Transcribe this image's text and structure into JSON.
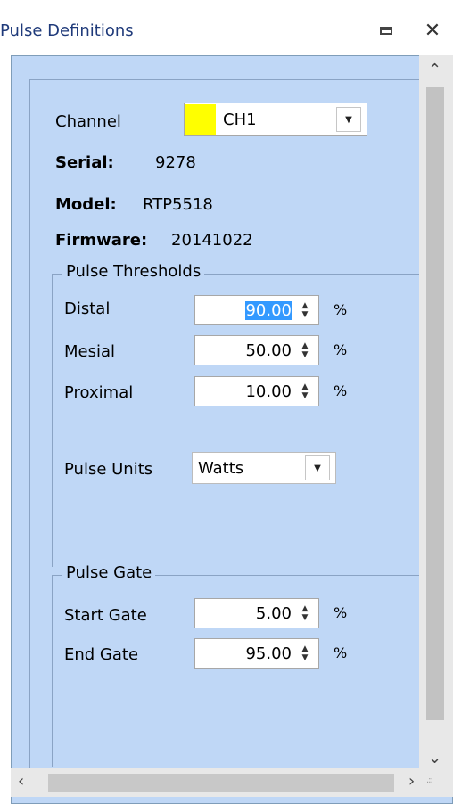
{
  "window": {
    "title": "Pulse Definitions"
  },
  "device": {
    "channel_label": "Channel",
    "channel_value": "CH1",
    "channel_color": "#ffff00",
    "serial_label": "Serial:",
    "serial_value": "9278",
    "model_label": "Model:",
    "model_value": "RTP5518",
    "firmware_label": "Firmware:",
    "firmware_value": "20141022"
  },
  "thresholds": {
    "title": "Pulse Thresholds",
    "distal_label": "Distal",
    "distal_value": "90.00",
    "mesial_label": "Mesial",
    "mesial_value": "50.00",
    "proximal_label": "Proximal",
    "proximal_value": "10.00",
    "unit": "%",
    "units_label": "Pulse Units",
    "units_value": "Watts"
  },
  "gate": {
    "title": "Pulse Gate",
    "start_label": "Start Gate",
    "start_value": "5.00",
    "end_label": "End Gate",
    "end_value": "95.00",
    "unit": "%"
  },
  "icons": {
    "pin": "pin-icon",
    "close": "close-icon"
  }
}
